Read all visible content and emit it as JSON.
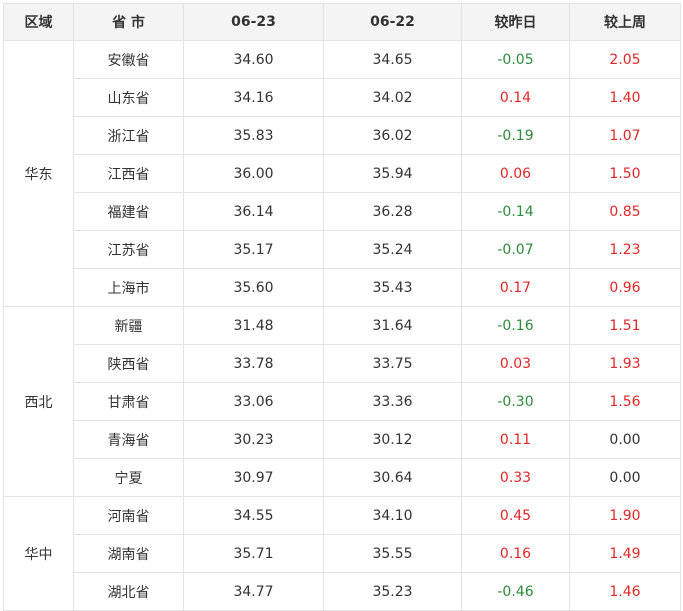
{
  "headers": [
    "区域",
    "省 市",
    "06-23",
    "06-22",
    "较昨日",
    "较上周"
  ],
  "colors": {
    "negative": "#2e8b3a",
    "positive": "#e02828",
    "neutral": "#333333",
    "header_bg": "#f4f4f4",
    "border": "#e3e3e3"
  },
  "regions": [
    {
      "name": "华东",
      "rows": [
        {
          "province": "安徽省",
          "d0623": "34.60",
          "d0622": "34.65",
          "vs_yesterday": "-0.05",
          "vs_last_week": "2.05"
        },
        {
          "province": "山东省",
          "d0623": "34.16",
          "d0622": "34.02",
          "vs_yesterday": "0.14",
          "vs_last_week": "1.40"
        },
        {
          "province": "浙江省",
          "d0623": "35.83",
          "d0622": "36.02",
          "vs_yesterday": "-0.19",
          "vs_last_week": "1.07"
        },
        {
          "province": "江西省",
          "d0623": "36.00",
          "d0622": "35.94",
          "vs_yesterday": "0.06",
          "vs_last_week": "1.50"
        },
        {
          "province": "福建省",
          "d0623": "36.14",
          "d0622": "36.28",
          "vs_yesterday": "-0.14",
          "vs_last_week": "0.85"
        },
        {
          "province": "江苏省",
          "d0623": "35.17",
          "d0622": "35.24",
          "vs_yesterday": "-0.07",
          "vs_last_week": "1.23"
        },
        {
          "province": "上海市",
          "d0623": "35.60",
          "d0622": "35.43",
          "vs_yesterday": "0.17",
          "vs_last_week": "0.96"
        }
      ]
    },
    {
      "name": "西北",
      "rows": [
        {
          "province": "新疆",
          "d0623": "31.48",
          "d0622": "31.64",
          "vs_yesterday": "-0.16",
          "vs_last_week": "1.51"
        },
        {
          "province": "陕西省",
          "d0623": "33.78",
          "d0622": "33.75",
          "vs_yesterday": "0.03",
          "vs_last_week": "1.93"
        },
        {
          "province": "甘肃省",
          "d0623": "33.06",
          "d0622": "33.36",
          "vs_yesterday": "-0.30",
          "vs_last_week": "1.56"
        },
        {
          "province": "青海省",
          "d0623": "30.23",
          "d0622": "30.12",
          "vs_yesterday": "0.11",
          "vs_last_week": "0.00"
        },
        {
          "province": "宁夏",
          "d0623": "30.97",
          "d0622": "30.64",
          "vs_yesterday": "0.33",
          "vs_last_week": "0.00"
        }
      ]
    },
    {
      "name": "华中",
      "rows": [
        {
          "province": "河南省",
          "d0623": "34.55",
          "d0622": "34.10",
          "vs_yesterday": "0.45",
          "vs_last_week": "1.90"
        },
        {
          "province": "湖南省",
          "d0623": "35.71",
          "d0622": "35.55",
          "vs_yesterday": "0.16",
          "vs_last_week": "1.49"
        },
        {
          "province": "湖北省",
          "d0623": "34.77",
          "d0622": "35.23",
          "vs_yesterday": "-0.46",
          "vs_last_week": "1.46"
        }
      ]
    }
  ]
}
